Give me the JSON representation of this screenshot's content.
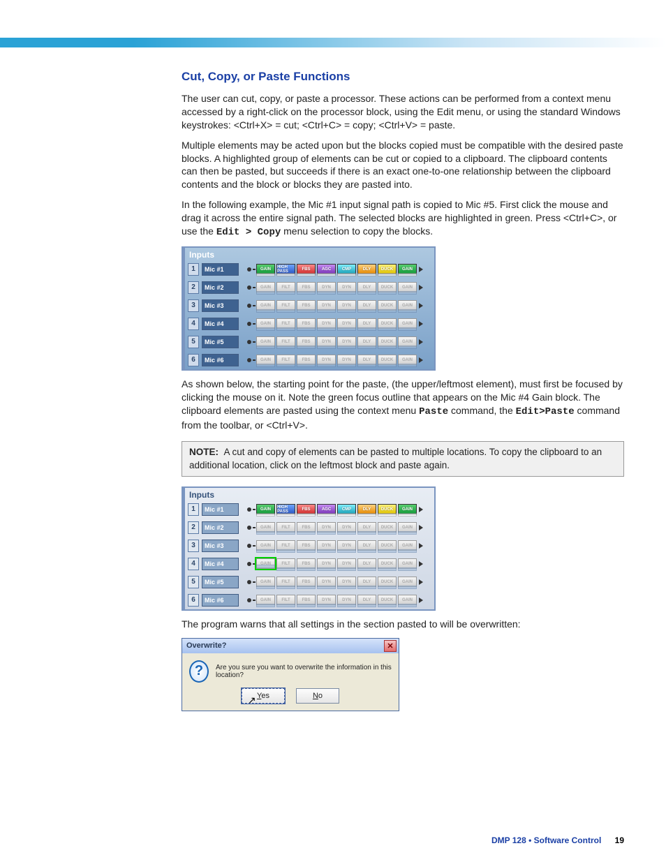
{
  "heading": "Cut, Copy, or Paste Functions",
  "para1a": "The user can cut, copy, or paste a processor. These actions can be performed from a context menu accessed by a right-click on the processor block, using the Edit menu, or using the standard Windows keystrokes: <Ctrl+X> = cut; <Ctrl+C> = copy; <Ctrl+V> = paste.",
  "para2": "Multiple elements may be acted upon but the blocks copied must be compatible with the desired paste blocks. A highlighted group of elements can be cut or copied to a clipboard. The clipboard contents can then be pasted, but succeeds if there is an exact one-to-one relationship between the clipboard contents and the block or blocks they are pasted into.",
  "para3_pre": "In the following example, the Mic #1 input signal path is copied to Mic #5. First click the mouse and drag it across the entire signal path. The selected blocks are highlighted in green. Press <Ctrl+C>, or use the ",
  "para3_mono": "Edit > Copy",
  "para3_post": " menu selection to copy the blocks.",
  "panel1_title": "Inputs",
  "panel2_title": "Inputs",
  "inputs": [
    "Mic #1",
    "Mic #2",
    "Mic #3",
    "Mic #4",
    "Mic #5",
    "Mic #6"
  ],
  "row1_blocks": [
    "GAIN",
    "HIGH PASS",
    "FBS",
    "AGC",
    "CMP",
    "DLY",
    "DUCK",
    "GAIN"
  ],
  "other_blocks": [
    "GAIN",
    "FILT",
    "FBS",
    "DYN",
    "DYN",
    "DLY",
    "DUCK",
    "GAIN"
  ],
  "para4_pre": "As shown below, the starting point for the paste, (the upper/leftmost element), must first be focused by clicking the mouse on it. Note the green focus outline that appears on the Mic #4 Gain block. The clipboard elements are pasted using the context menu ",
  "para4_mono1": "Paste",
  "para4_mid": " command, the ",
  "para4_mono2": "Edit>Paste",
  "para4_post": " command from the toolbar, or <Ctrl+V>.",
  "note_label": "NOTE:",
  "note_body": "A cut and copy of elements can be pasted to multiple locations. To copy the clipboard to an additional location, click on the leftmost block and paste again.",
  "para5": "The program warns that all settings in the section pasted to will be overwritten:",
  "dialog": {
    "title": "Overwrite?",
    "body": "Are you sure you want to overwrite the information in this location?",
    "yes": "Yes",
    "no": "No"
  },
  "footer_product": "DMP 128 • Software Control",
  "footer_page": "19"
}
